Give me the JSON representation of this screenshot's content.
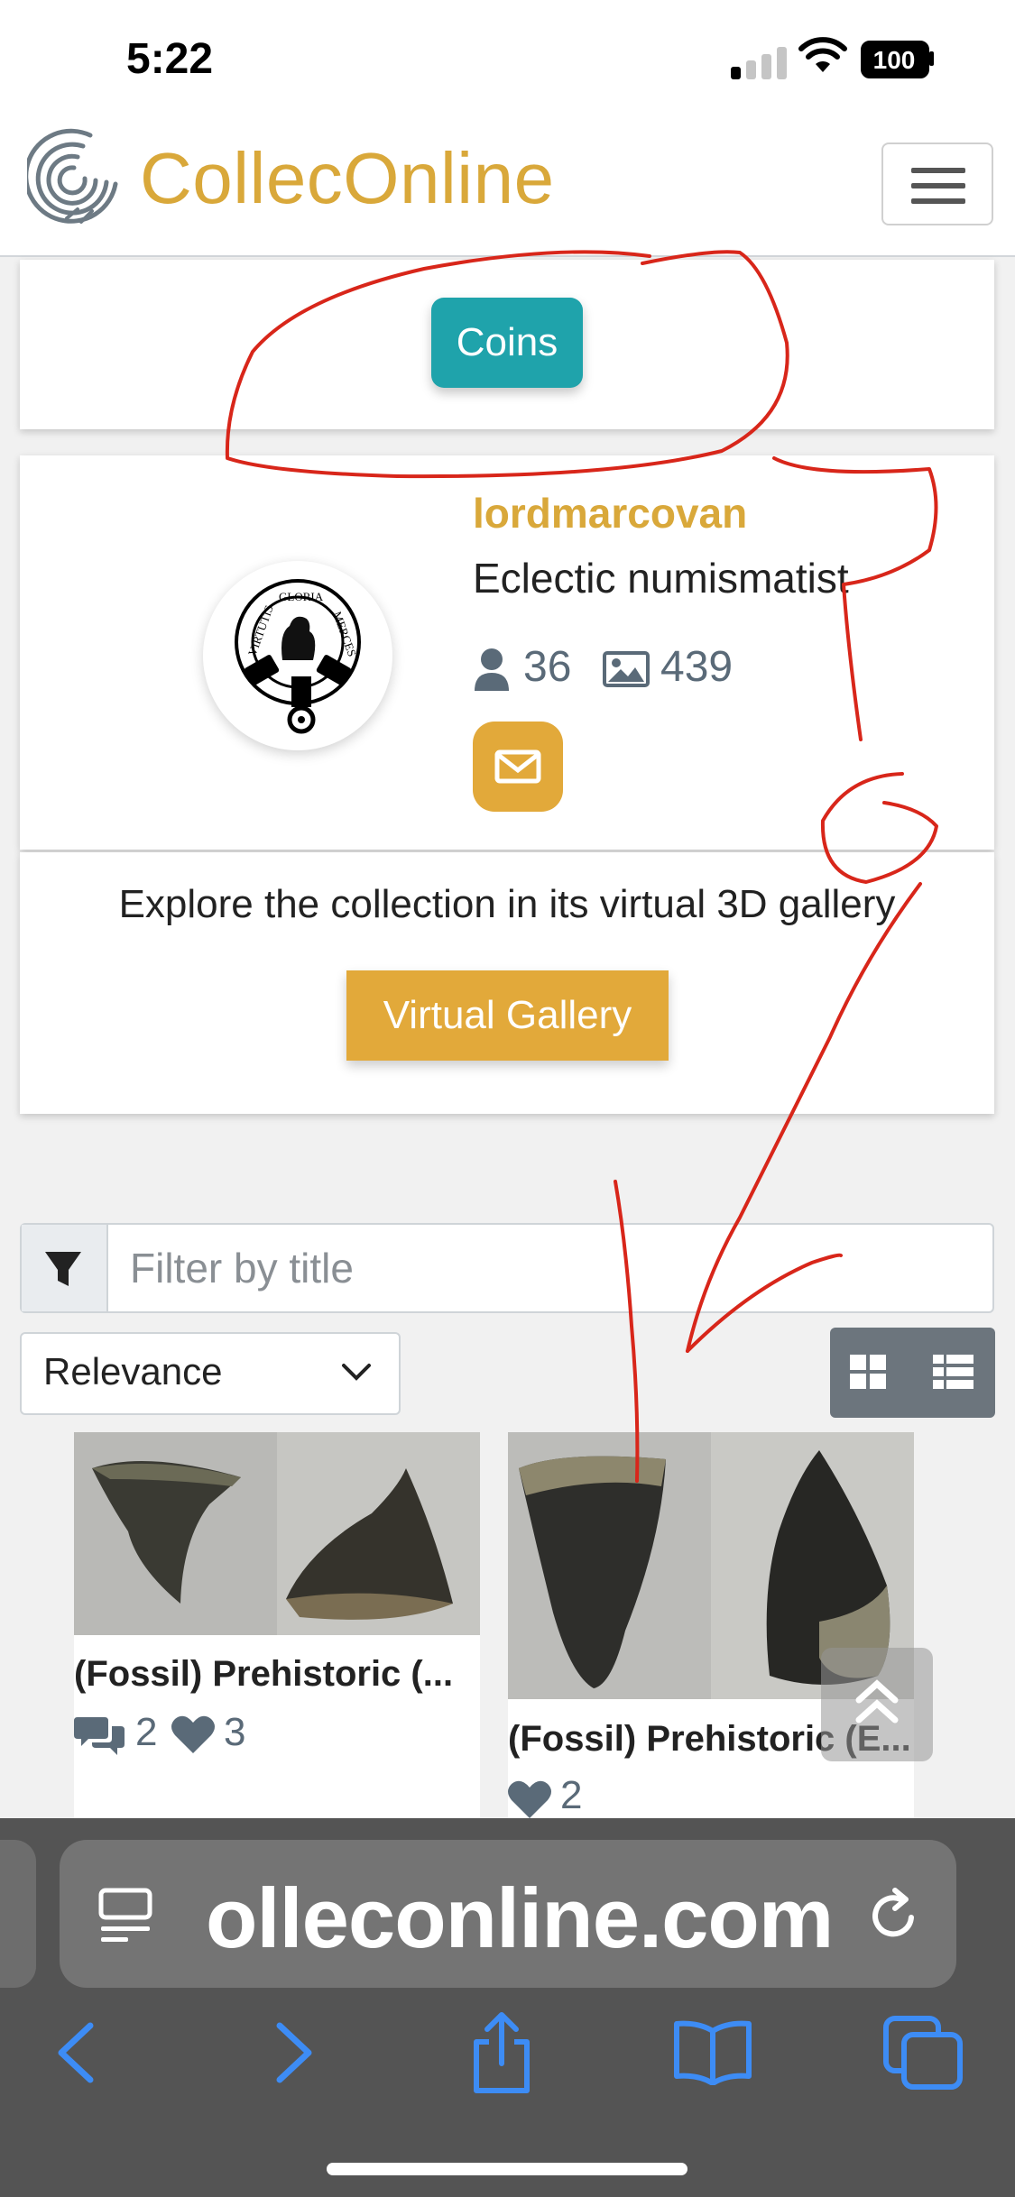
{
  "status_bar": {
    "time": "5:22",
    "battery": "100"
  },
  "nav": {
    "brand": "CollecOnline"
  },
  "category": {
    "label": "Coins"
  },
  "profile": {
    "username": "lordmarcovan",
    "bio": "Eclectic numismatist",
    "followers": "36",
    "images": "439",
    "avatar_text_left": "VIRTUTIS",
    "avatar_text_top": "GLORIA",
    "avatar_text_right": "MERCES"
  },
  "gallery": {
    "prompt": "Explore the collection in its virtual 3D gallery",
    "button": "Virtual Gallery"
  },
  "filter": {
    "placeholder": "Filter by title"
  },
  "sort": {
    "selected": "Relevance"
  },
  "items": [
    {
      "title": "(Fossil) Prehistoric (...",
      "comments": "2",
      "likes": "3"
    },
    {
      "title": "(Fossil) Prehistoric (E...",
      "likes": "2"
    }
  ],
  "browser": {
    "url": "olleconline.com"
  },
  "colors": {
    "brand_gold": "#d9a83a",
    "teal": "#1fa3ab",
    "button_gold": "#e2a93a",
    "annotation_red": "#d8261a"
  }
}
